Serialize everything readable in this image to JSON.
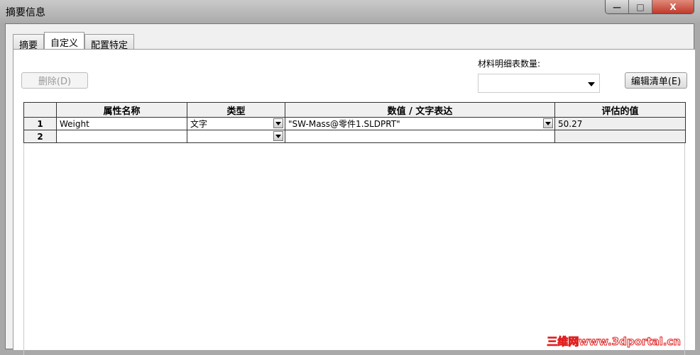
{
  "window": {
    "title": "摘要信息",
    "minimize": "—",
    "maximize": "□",
    "close": "X"
  },
  "tabs": [
    {
      "label": "摘要"
    },
    {
      "label": "自定义"
    },
    {
      "label": "配置特定"
    }
  ],
  "toolbar": {
    "delete_label": "删除(D)",
    "bom_qty_label": "材料明细表数量:",
    "bom_qty_value": "",
    "edit_list_label": "编辑清单(E)"
  },
  "table": {
    "headers": [
      "",
      "属性名称",
      "类型",
      "数值 / 文字表达",
      "评估的值"
    ],
    "rows": [
      {
        "num": "1",
        "name": "Weight",
        "type": "文字",
        "value": "\"SW-Mass@零件1.SLDPRT\"",
        "evaluated": "50.27"
      },
      {
        "num": "2",
        "name": "",
        "type": "",
        "value": "",
        "evaluated": ""
      }
    ]
  },
  "watermark": "三维网www.3dportal.cn"
}
